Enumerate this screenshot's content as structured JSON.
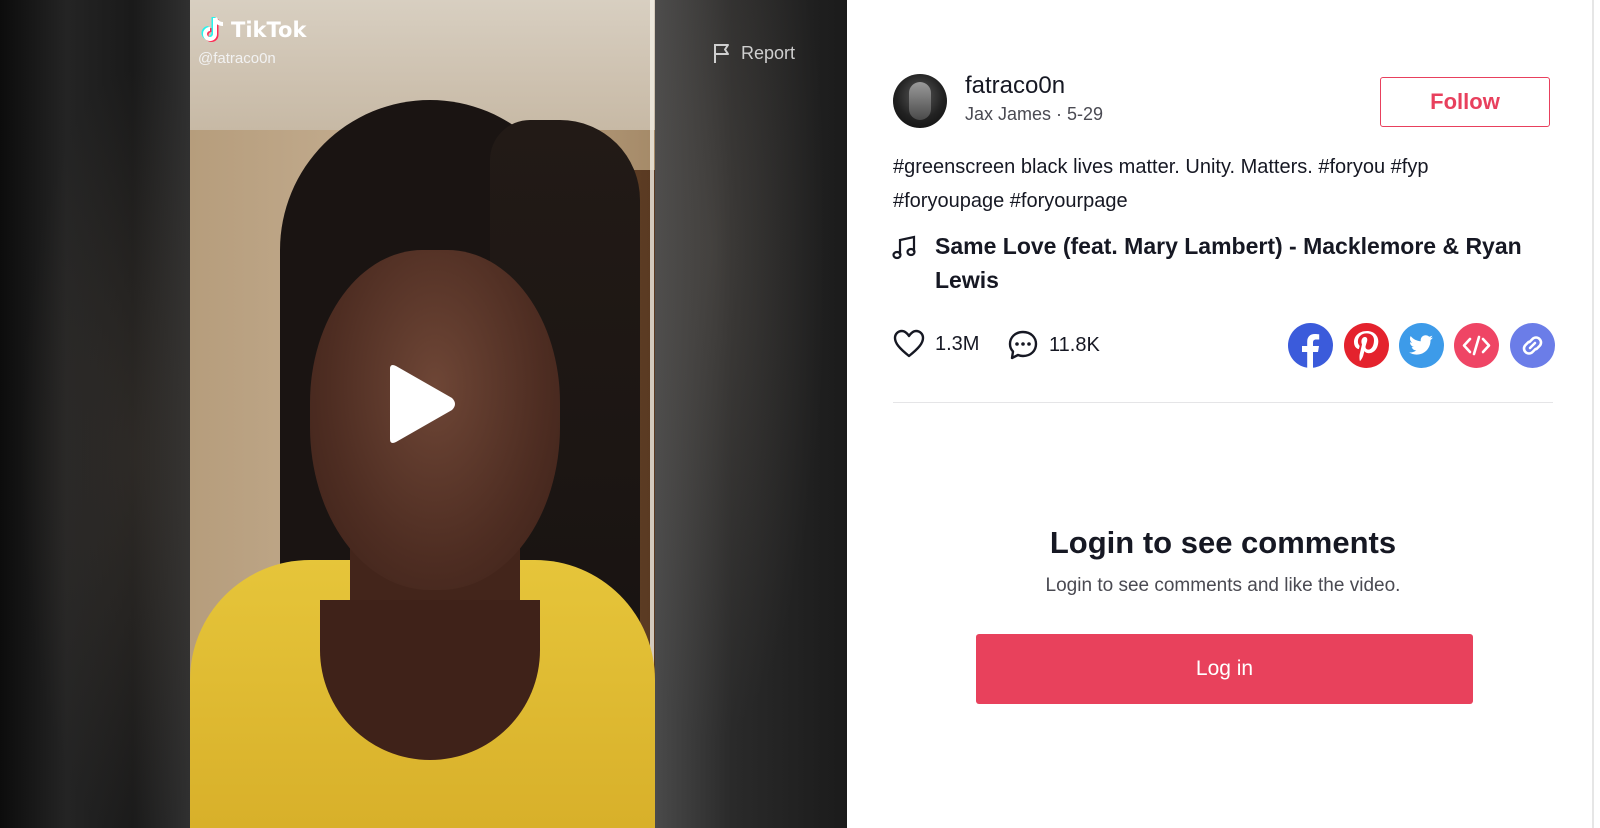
{
  "video": {
    "brand": "TikTok",
    "handle": "@fatraco0n",
    "report_label": "Report"
  },
  "author": {
    "username": "fatraco0n",
    "subline": "Jax James · 5-29",
    "follow_label": "Follow"
  },
  "caption": {
    "line1_tag1": "#greenscreen",
    "line1_text": " black lives matter. Unity. Matters. ",
    "line1_tag2": "#foryou",
    "line1_tag3": "#fyp",
    "line2_tag1": "#foryoupage",
    "line2_tag2": "#foryourpage"
  },
  "music": {
    "title": "Same Love (feat. Mary Lambert) - Macklemore & Ryan Lewis"
  },
  "stats": {
    "likes": "1.3M",
    "comments": "11.8K"
  },
  "share": {
    "colors": {
      "facebook": "#3b5bdb",
      "pinterest": "#e4222d",
      "twitter": "#3d9be9",
      "embed": "#ef4565",
      "link": "#6b7de8"
    }
  },
  "login": {
    "title": "Login to see comments",
    "subtitle": "Login to see comments and like the video.",
    "button_label": "Log in"
  },
  "colors": {
    "accent": "#e8415c",
    "text": "#161823"
  }
}
